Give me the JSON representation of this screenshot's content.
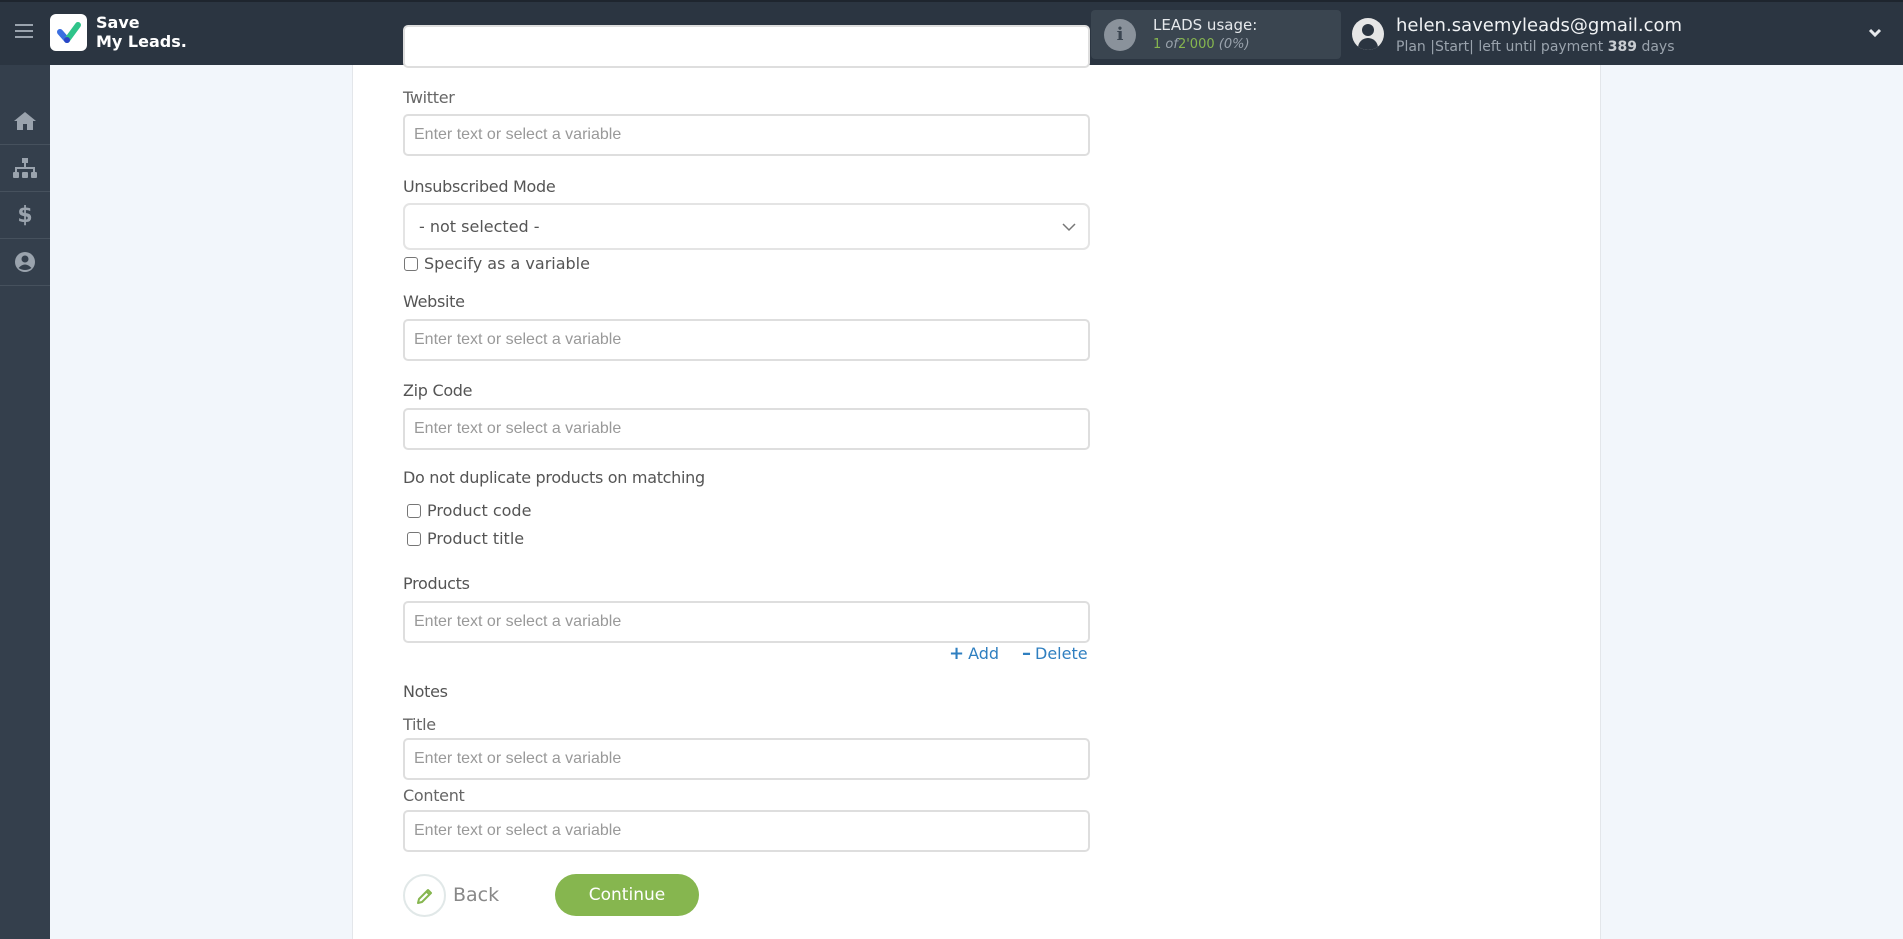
{
  "header": {
    "logo_line1": "Save",
    "logo_line2": "My Leads.",
    "leads_title": "LEADS usage:",
    "leads_used": "1",
    "leads_of": "of",
    "leads_total": "2'000",
    "leads_percent": "(0%)",
    "user_email": "helen.savemyleads@gmail.com",
    "plan_prefix": "Plan",
    "plan_name": "|Start|",
    "plan_left": "left until payment",
    "plan_days": "389",
    "plan_days_suffix": "days"
  },
  "sidebar": {
    "items": [
      {
        "name": "home",
        "icon": "home-icon"
      },
      {
        "name": "connections",
        "icon": "sitemap-icon"
      },
      {
        "name": "billing",
        "icon": "dollar-icon"
      },
      {
        "name": "account",
        "icon": "user-circle-icon"
      }
    ]
  },
  "form": {
    "placeholder": "Enter text or select a variable",
    "twitter_label": "Twitter",
    "unsubscribed_label": "Unsubscribed Mode",
    "unsubscribed_value": "- not selected -",
    "specify_variable_label": "Specify as a variable",
    "website_label": "Website",
    "zip_label": "Zip Code",
    "no_duplicate_label": "Do not duplicate products on matching",
    "product_code_label": "Product code",
    "product_title_label": "Product title",
    "products_label": "Products",
    "add_label": "Add",
    "delete_label": "Delete",
    "notes_label": "Notes",
    "notes_title_label": "Title",
    "notes_content_label": "Content"
  },
  "actions": {
    "back_label": "Back",
    "continue_label": "Continue"
  },
  "colors": {
    "accent_green": "#86b64f",
    "link_blue": "#2f7fc0",
    "header_bg": "#2b3541",
    "sidebar_bg": "#343f4c"
  }
}
